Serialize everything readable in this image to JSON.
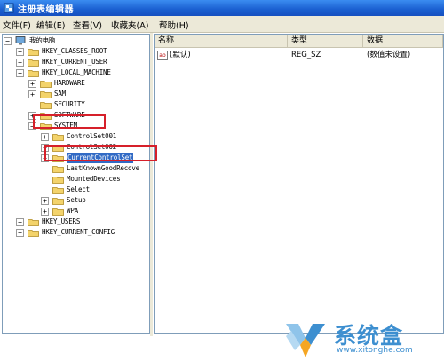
{
  "window": {
    "title": "注册表编辑器"
  },
  "menu": [
    "文件(F)",
    "编辑(E)",
    "查看(V)",
    "收藏夹(A)",
    "帮助(H)"
  ],
  "tree": [
    {
      "label": "我的电脑",
      "expander": "−"
    },
    {
      "label": "HKEY_CLASSES_ROOT",
      "expander": "+"
    },
    {
      "label": "HKEY_CURRENT_USER",
      "expander": "+"
    },
    {
      "label": "HKEY_LOCAL_MACHINE",
      "expander": "−"
    },
    {
      "label": "HARDWARE",
      "expander": "+"
    },
    {
      "label": "SAM",
      "expander": "+"
    },
    {
      "label": "SECURITY",
      "expander": ""
    },
    {
      "label": "SOFTWARE",
      "expander": "+"
    },
    {
      "label": "SYSTEM",
      "expander": "−"
    },
    {
      "label": "ControlSet001",
      "expander": "+"
    },
    {
      "label": "ControlSet002",
      "expander": "+"
    },
    {
      "label": "CurrentControlSet",
      "expander": "+"
    },
    {
      "label": "LastKnownGoodRecove",
      "expander": ""
    },
    {
      "label": "MountedDevices",
      "expander": ""
    },
    {
      "label": "Select",
      "expander": ""
    },
    {
      "label": "Setup",
      "expander": "+"
    },
    {
      "label": "WPA",
      "expander": "+"
    },
    {
      "label": "HKEY_USERS",
      "expander": "+"
    },
    {
      "label": "HKEY_CURRENT_CONFIG",
      "expander": "+"
    }
  ],
  "list": {
    "columns": [
      "名称",
      "类型",
      "数据"
    ],
    "rows": [
      {
        "icon": "ab",
        "name": "(默认)",
        "type": "REG_SZ",
        "data": "(数值未设置)"
      }
    ]
  },
  "watermark": {
    "text": "系统盒",
    "url": "www.xitonghe.com"
  },
  "colors": {
    "titlebar": "#1a5fd0",
    "highlight_box": "#d6202a",
    "selection": "#316ac5"
  }
}
